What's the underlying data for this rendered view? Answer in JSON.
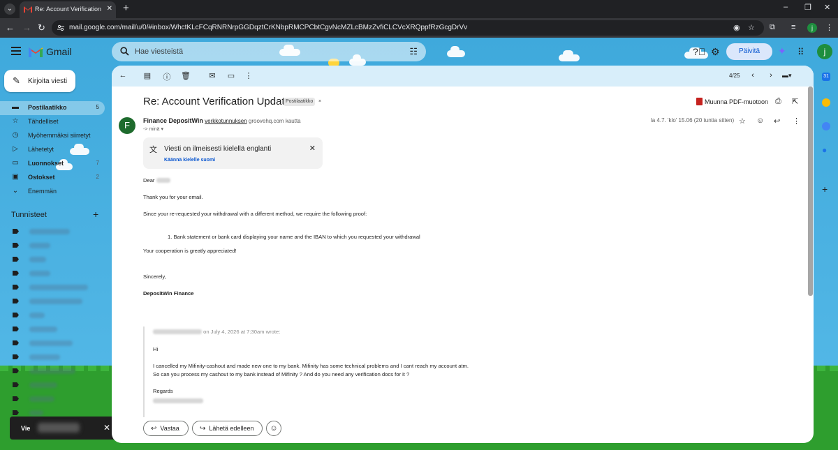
{
  "browser": {
    "tab_title": "Re: Account Verification Update",
    "url": "mail.google.com/mail/u/0/#inbox/WhctKLcFCqRNRNrpGGDqztCrKNbpRMCPCbtCgvNcMZLcBMzZvfiCLCVcXRQppfRzGcgDrVv",
    "profile_initial": "j",
    "window_controls": [
      "–",
      "❐",
      "✕"
    ]
  },
  "header": {
    "app_name": "Gmail",
    "search_placeholder": "Hae viesteistä",
    "update_label": "Päivitä",
    "avatar_initial": "j"
  },
  "sidebar": {
    "compose_label": "Kirjoita viesti",
    "items": [
      {
        "label": "Postilaatikko",
        "count": "5",
        "icon": "inbox-icon",
        "glyph": "▬",
        "active": true,
        "bold": true
      },
      {
        "label": "Tähdelliset",
        "count": "",
        "icon": "star-icon",
        "glyph": "☆",
        "active": false,
        "bold": false
      },
      {
        "label": "Myöhemmäksi siirretyt",
        "count": "",
        "icon": "clock-icon",
        "glyph": "◷",
        "active": false,
        "bold": false
      },
      {
        "label": "Lähetetyt",
        "count": "",
        "icon": "send-icon",
        "glyph": "▷",
        "active": false,
        "bold": false
      },
      {
        "label": "Luonnokset",
        "count": "7",
        "icon": "draft-icon",
        "glyph": "▭",
        "active": false,
        "bold": true
      },
      {
        "label": "Ostokset",
        "count": "2",
        "icon": "shopping-icon",
        "glyph": "▣",
        "active": false,
        "bold": true
      },
      {
        "label": "Enemmän",
        "count": "",
        "icon": "chevron-down-icon",
        "glyph": "⌄",
        "active": false,
        "bold": false
      }
    ],
    "labels_title": "Tunnisteet",
    "labels_add": "+",
    "snackbar_text": "Vie"
  },
  "message": {
    "subject": "Re: Account Verification Update",
    "folder_chip": "Postilaatikko",
    "pdf_label": "Muunna PDF-muotoon",
    "sender_initial": "F",
    "sender_name": "Finance DepositWin",
    "sender_via_link": "verkkotunnuksen",
    "sender_domain": "groovehq.com",
    "sender_via_word": "kautta",
    "to_line": "-> minä",
    "date": "la 4.7. 'klo' 15.06 (20 tuntia sitten)",
    "pager": "4/25",
    "translate_title": "Viesti on ilmeisesti kielellä englanti",
    "translate_link": "Käännä kielelle suomi",
    "body": {
      "greeting": "Dear",
      "line1": "Thank you for your email.",
      "line2": "Since your re-requested your withdrawal with a different method, we require the following proof:",
      "list_item": "1. Bank statement or bank card displaying your name and the IBAN to which you requested your withdrawal",
      "line3": "Your cooperation is greatly appreciated!",
      "signoff": "Sincerely,",
      "signature": "DepositWin Finance"
    },
    "quote": {
      "header": "on July 4, 2026 at 7:30am wrote:",
      "greeting": "Hi",
      "line1": "I cancelled my Mifinity-cashout and made new one to my bank. Mifinity has some technical problems and I cant reach my account atm.",
      "line2": "So can you process my cashout to my bank instead of Mifinity ? And do you need any verification docs for it ?",
      "regards": "Regards"
    },
    "reply_label": "Vastaa",
    "forward_label": "Lähetä edelleen"
  },
  "colors": {
    "theme_sky": "#3fa9dc",
    "grass": "#2e9e2e",
    "accent": "#0b57d0",
    "sender_avatar": "#1e6b2d"
  }
}
